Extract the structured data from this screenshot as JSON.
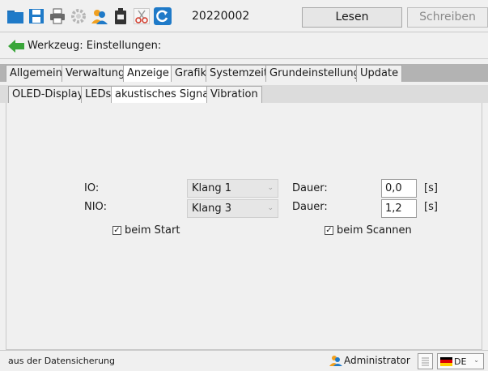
{
  "toolbar": {
    "number": "20220002",
    "read_label": "Lesen",
    "write_label": "Schreiben",
    "icons": [
      "folder-icon",
      "save-icon",
      "print-icon",
      "settings-gear-icon",
      "users-icon",
      "battery-icon",
      "scissors-icon",
      "refresh-icon"
    ]
  },
  "breadcrumb": {
    "text": "Werkzeug: Einstellungen:"
  },
  "tabs": [
    "Allgemein",
    "Verwaltung",
    "Anzeige",
    "Grafik",
    "Systemzeit",
    "Grundeinstellung",
    "Update"
  ],
  "active_tab": "Anzeige",
  "subtabs": [
    "OLED-Display",
    "LEDs",
    "akustisches Signal",
    "Vibration"
  ],
  "active_subtab": "akustisches Signal",
  "form": {
    "io_label": "IO:",
    "nio_label": "NIO:",
    "io_sound": "Klang 1",
    "nio_sound": "Klang 3",
    "duration_label": "Dauer:",
    "io_duration": "0,0",
    "nio_duration": "1,2",
    "unit": "[s]",
    "start_check_label": "beim Start",
    "start_checked": true,
    "scan_check_label": "beim Scannen",
    "scan_checked": true
  },
  "status": {
    "message": "aus der Datensicherung",
    "user": "Administrator",
    "language": "DE"
  },
  "colors": {
    "window_bg": "#f0f0f0",
    "tab_strip": "#b3b3b3",
    "active_tab": "#ffffff",
    "accent_blue": "#1f7ac8",
    "accent_green": "#3aa63a"
  }
}
